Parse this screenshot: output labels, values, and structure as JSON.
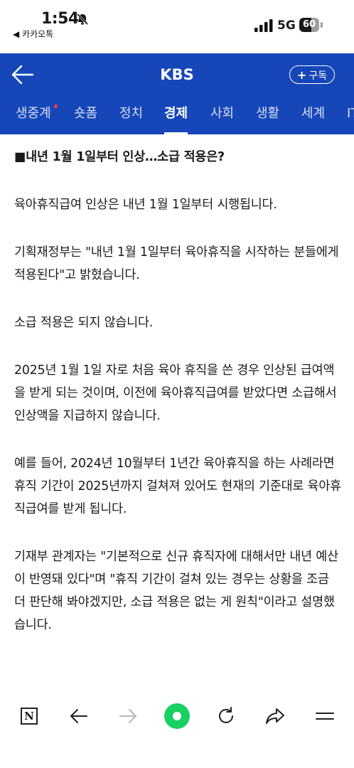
{
  "status_bar": {
    "time": "1:54",
    "back_app": "◀ 카카오톡",
    "network": "5G",
    "battery_level": 60,
    "battery_text": "60"
  },
  "header": {
    "title": "KBS",
    "subscribe_label": "구독"
  },
  "tabs": [
    {
      "label": "생중계",
      "active": false,
      "live_dot": true
    },
    {
      "label": "숏폼",
      "active": false
    },
    {
      "label": "정치",
      "active": false
    },
    {
      "label": "경제",
      "active": true
    },
    {
      "label": "사회",
      "active": false
    },
    {
      "label": "생활",
      "active": false
    },
    {
      "label": "세계",
      "active": false
    },
    {
      "label": "IT",
      "active": false
    }
  ],
  "article": {
    "heading": "■내년 1월 1일부터 인상…소급 적용은?",
    "paragraphs": [
      "육아휴직급여 인상은 내년 1월 1일부터 시행됩니다.",
      "기획재정부는 \"내년 1월 1일부터 육아휴직을 시작하는 분들에게 적용된다\"고 밝혔습니다.",
      "소급 적용은 되지 않습니다.",
      "2025년 1월 1일 자로 처음 육아 휴직을 쓴 경우 인상된 급여액을 받게 되는 것이며, 이전에 육아휴직급여를 받았다면 소급해서 인상액을 지급하지 않습니다.",
      "예를 들어, 2024년 10월부터 1년간 육아휴직을 하는 사례라면 휴직 기간이 2025년까지 걸쳐져 있어도 현재의 기준대로 육아휴직급여를 받게 됩니다.",
      "기재부 관계자는 \"기본적으로 신규 휴직자에 대해서만 내년 예산이 반영돼 있다\"며 \"휴직 기간이 걸쳐 있는 경우는 상황을 조금 더 판단해 봐야겠지만, 소급 적용은 없는 게 원칙\"이라고 설명했습니다."
    ]
  },
  "toolbar": {
    "n_label": "N",
    "icons": [
      "naver-home-icon",
      "back-arrow-icon",
      "forward-arrow-icon",
      "green-dot-icon",
      "refresh-icon",
      "share-icon",
      "menu-icon"
    ]
  },
  "colors": {
    "header_bg": "#1646b8",
    "live_dot": "#ff3d3d",
    "green_button": "#19d161"
  }
}
